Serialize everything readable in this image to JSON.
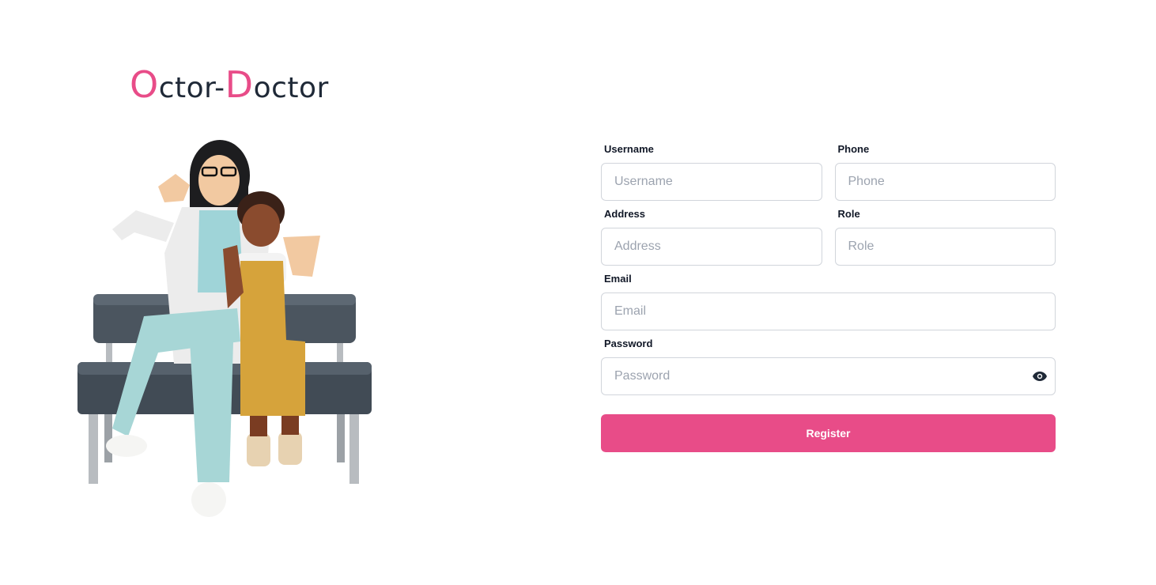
{
  "brand": {
    "first_cap": "O",
    "first_rest": "ctor-",
    "second_cap": "D",
    "second_rest": "octor",
    "accent_color": "#e84c88",
    "text_color": "#1f2937"
  },
  "illustration": {
    "description_icon": "doctor-and-child-on-bench-illustration"
  },
  "form": {
    "username": {
      "label": "Username",
      "placeholder": "Username",
      "value": ""
    },
    "phone": {
      "label": "Phone",
      "placeholder": "Phone",
      "value": ""
    },
    "address": {
      "label": "Address",
      "placeholder": "Address",
      "value": ""
    },
    "role": {
      "label": "Role",
      "placeholder": "Role",
      "value": ""
    },
    "email": {
      "label": "Email",
      "placeholder": "Email",
      "value": ""
    },
    "password": {
      "label": "Password",
      "placeholder": "Password",
      "value": "",
      "toggle_icon": "eye-icon"
    },
    "submit_label": "Register",
    "submit_color": "#e84c88"
  }
}
